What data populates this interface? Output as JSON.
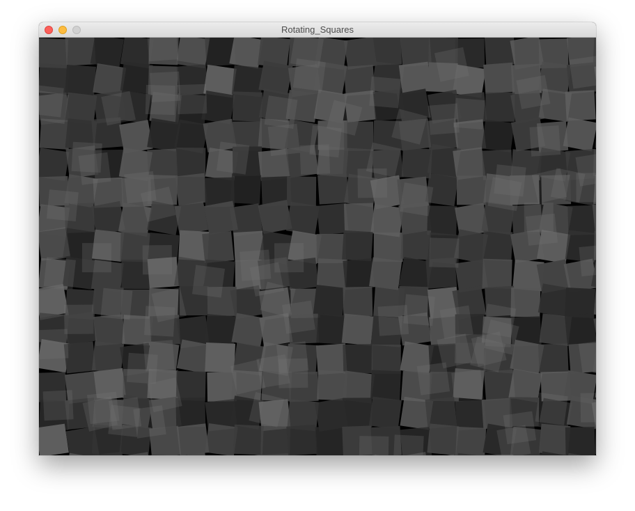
{
  "window": {
    "title": "Rotating_Squares",
    "controls": [
      {
        "name": "close",
        "color": "#fc605b"
      },
      {
        "name": "minimize",
        "color": "#fdbc40"
      },
      {
        "name": "zoom",
        "color": "#d1d1d1"
      }
    ]
  },
  "sketch": {
    "background": "#000000",
    "square_fill_alpha": 0.55,
    "gray_levels": [
      "#2a2a2a",
      "#333333",
      "#3c3c3c",
      "#444444",
      "#4d4d4d",
      "#565656",
      "#5f5f5f"
    ]
  }
}
